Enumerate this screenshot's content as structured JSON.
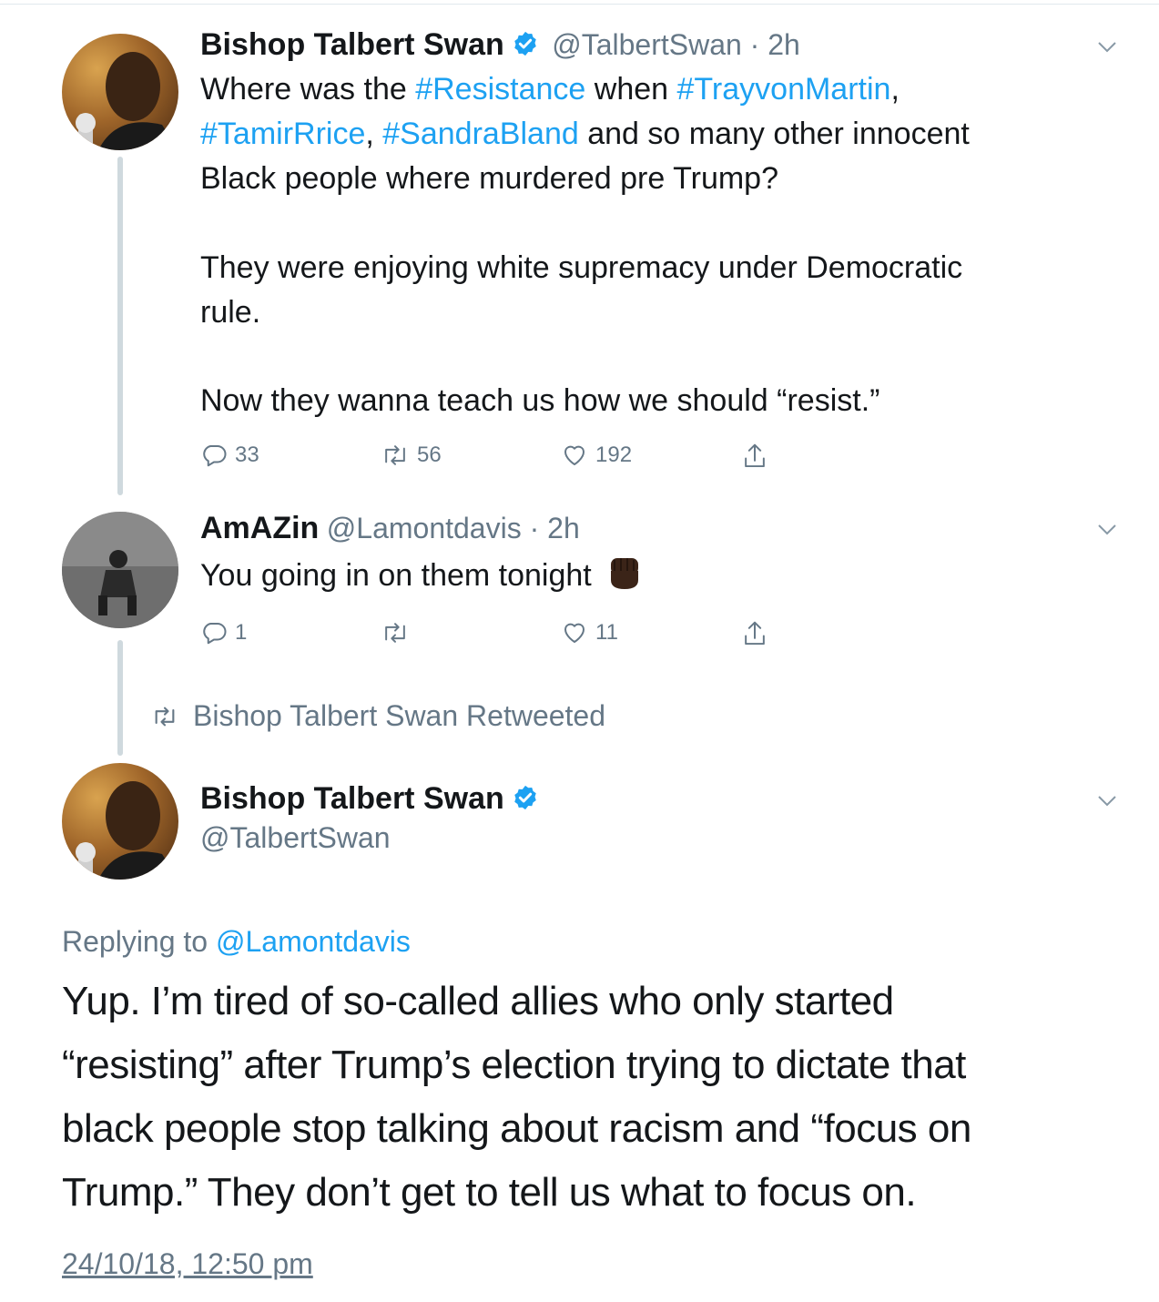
{
  "tweets": [
    {
      "name": "Bishop Talbert Swan",
      "handle": "@TalbertSwan",
      "time": "2h",
      "text_line1_a": "Where was the ",
      "text_line1_tag1": "#Resistance",
      "text_line1_b": " when ",
      "text_line1_tag2": "#TrayvonMartin",
      "text_line1_c": ",",
      "text_line2_tag1": "#TamirRrice",
      "text_line2_a": ", ",
      "text_line2_tag2": "#SandraBland",
      "text_line2_b": " and so many other innocent",
      "text_line3": "Black people where murdered pre Trump?",
      "text_para2_line1": "They were enjoying white supremacy under Democratic",
      "text_para2_line2": "rule.",
      "text_para3": "Now they wanna teach us how we should “resist.”",
      "replies": "33",
      "retweets": "56",
      "likes": "192"
    },
    {
      "name": "AmAZin",
      "handle": "@Lamontdavis",
      "time": "2h",
      "text": "You going in on them tonight",
      "replies": "1",
      "retweets": "",
      "likes": "11"
    }
  ],
  "retweeted_by": "Bishop Talbert Swan Retweeted",
  "main_tweet": {
    "name": "Bishop Talbert Swan",
    "handle": "@TalbertSwan",
    "replying_prefix": "Replying to ",
    "replying_to": "@Lamontdavis",
    "lines": [
      "Yup. I’m tired of so-called allies who only started",
      "“resisting” after Trump’s election trying to dictate that",
      "black people stop talking about racism and “focus on",
      "Trump.” They don’t get to tell us what to focus on."
    ],
    "timestamp": "24/10/18, 12:50 pm"
  },
  "icons": [
    "reply-icon",
    "retweet-icon",
    "like-icon",
    "share-icon",
    "verified-badge-icon",
    "chevron-down-icon",
    "raised-fist-emoji"
  ],
  "colors": {
    "link": "#1da1f2",
    "muted": "#657786",
    "text": "#14171a",
    "thread_line": "#cfd9de"
  }
}
